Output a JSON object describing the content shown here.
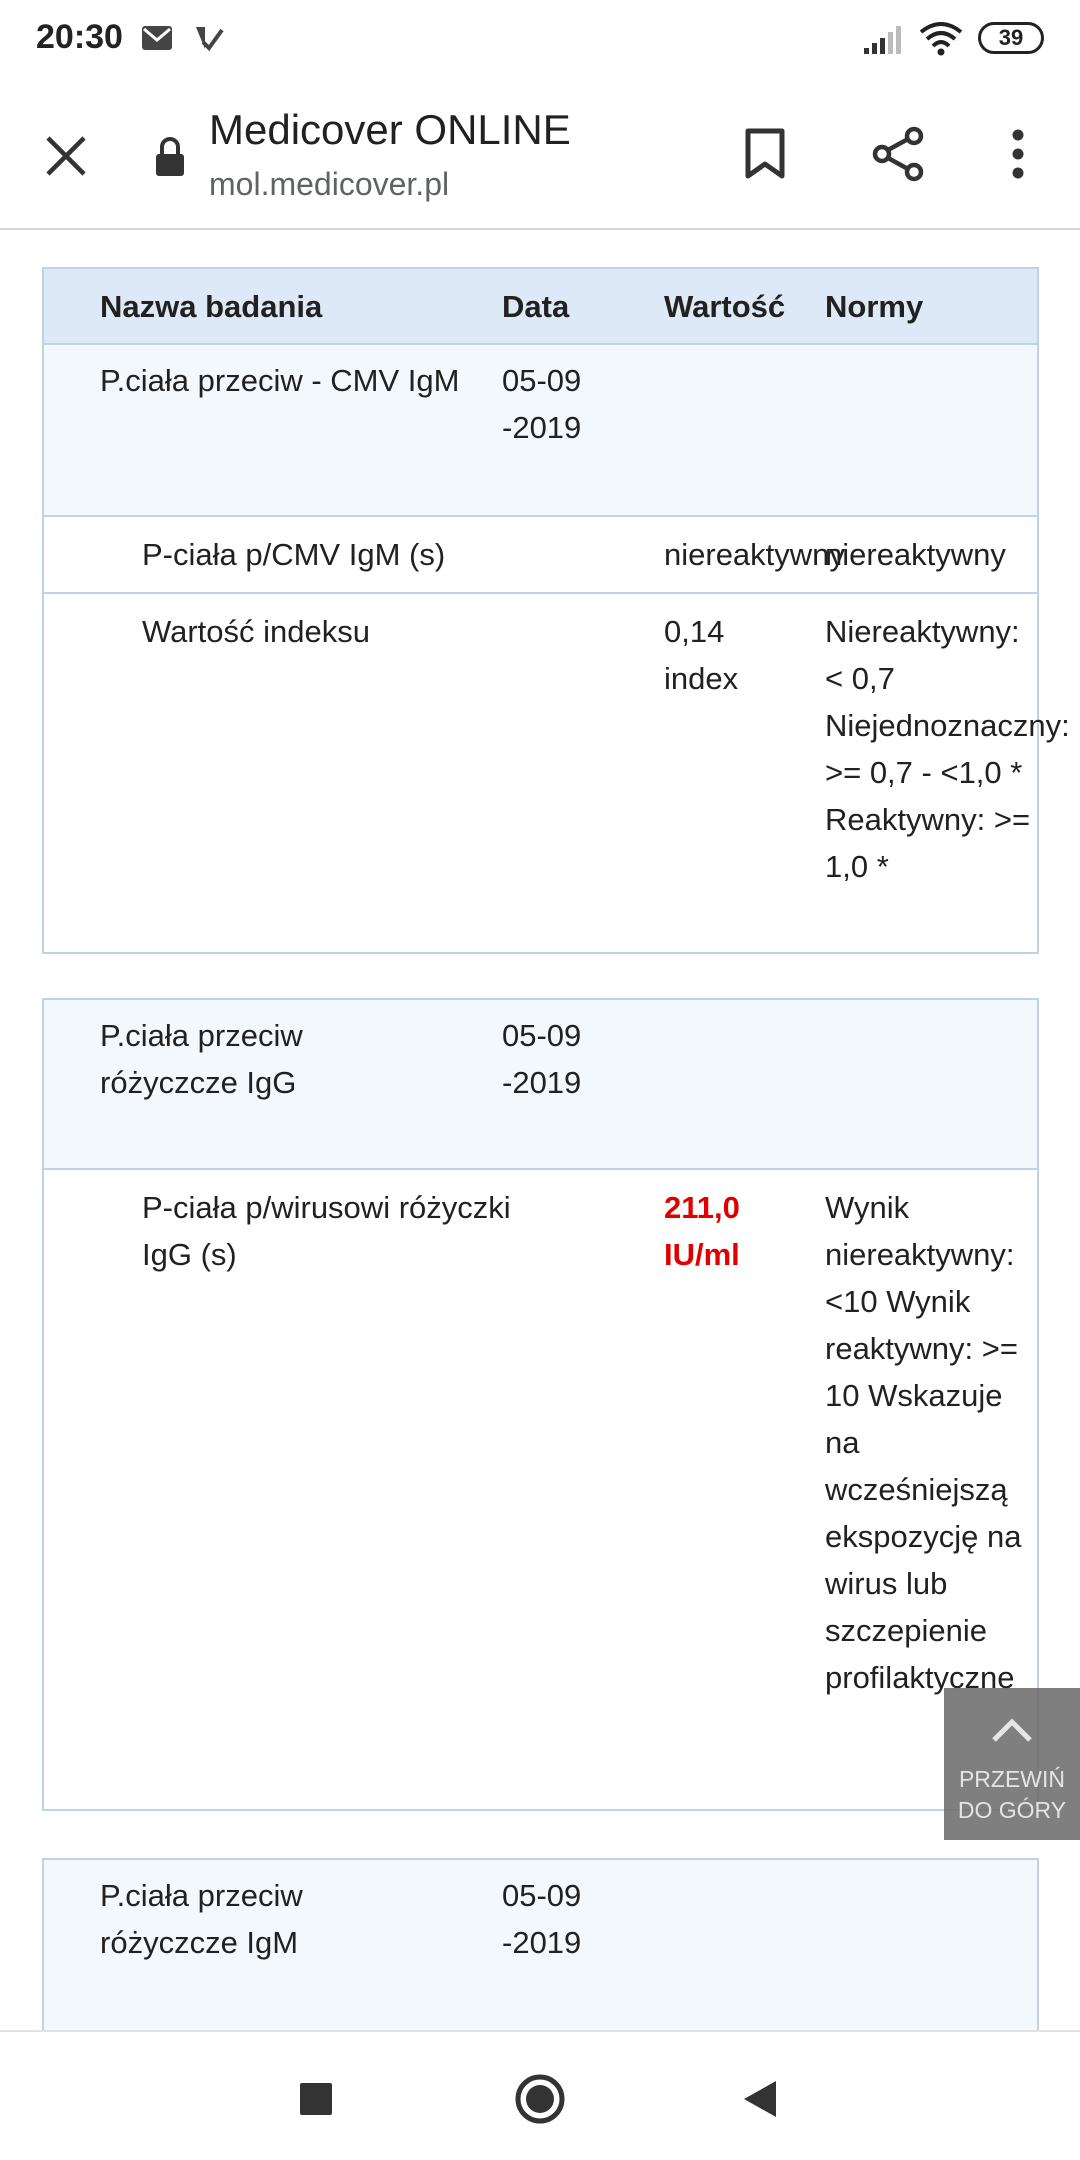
{
  "status_bar": {
    "time": "20:30",
    "battery": "39",
    "icons": [
      "mail-icon",
      "check-notification-icon",
      "signal-icon",
      "wifi-icon",
      "battery-icon"
    ]
  },
  "toolbar": {
    "title": "Medicover ONLINE",
    "url": "mol.medicover.pl",
    "icons": [
      "close-icon",
      "lock-icon",
      "bookmark-icon",
      "share-icon",
      "more-vert-icon"
    ]
  },
  "table": {
    "headers": {
      "name": "Nazwa badania",
      "date": "Data",
      "value": "Wartość",
      "norms": "Normy"
    },
    "groups": [
      {
        "name": "P.ciała przeciw - CMV IgM",
        "date": "05-09-2019",
        "rows": [
          {
            "name": "P-ciała p/CMV IgM (s)",
            "value": "niereaktywny",
            "norms": "niereaktywny"
          },
          {
            "name": "Wartość indeksu",
            "value": "0,14 index",
            "norms": "Niereaktywny: < 0,7 Niejednoznaczny: >= 0,7 - <1,0 * Reaktywny: >= 1,0 *"
          }
        ]
      },
      {
        "name": "P.ciała przeciw różyczcze IgG",
        "date": "05-09-2019",
        "rows": [
          {
            "name": "P-ciała p/wirusowi różyczki IgG (s)",
            "value": "211,0 IU/ml",
            "value_flag": "abnormal",
            "norms": "Wynik niereaktywny: <10 Wynik reaktywny: >= 10 Wskazuje na wcześniejszą ekspozycję na wirus lub szczepienie profilaktyczne"
          }
        ]
      },
      {
        "name": "P.ciała przeciw różyczcze IgM",
        "date": "05-09-2019",
        "rows": []
      }
    ]
  },
  "scroll_top": {
    "label": "PRZEWIŃ DO GÓRY"
  },
  "colors": {
    "header_bg": "#dde9f6",
    "border": "#bfd3e6",
    "abnormal": "#e00000"
  },
  "nav": {
    "icons": [
      "recent-apps-icon",
      "home-icon",
      "back-icon"
    ]
  }
}
